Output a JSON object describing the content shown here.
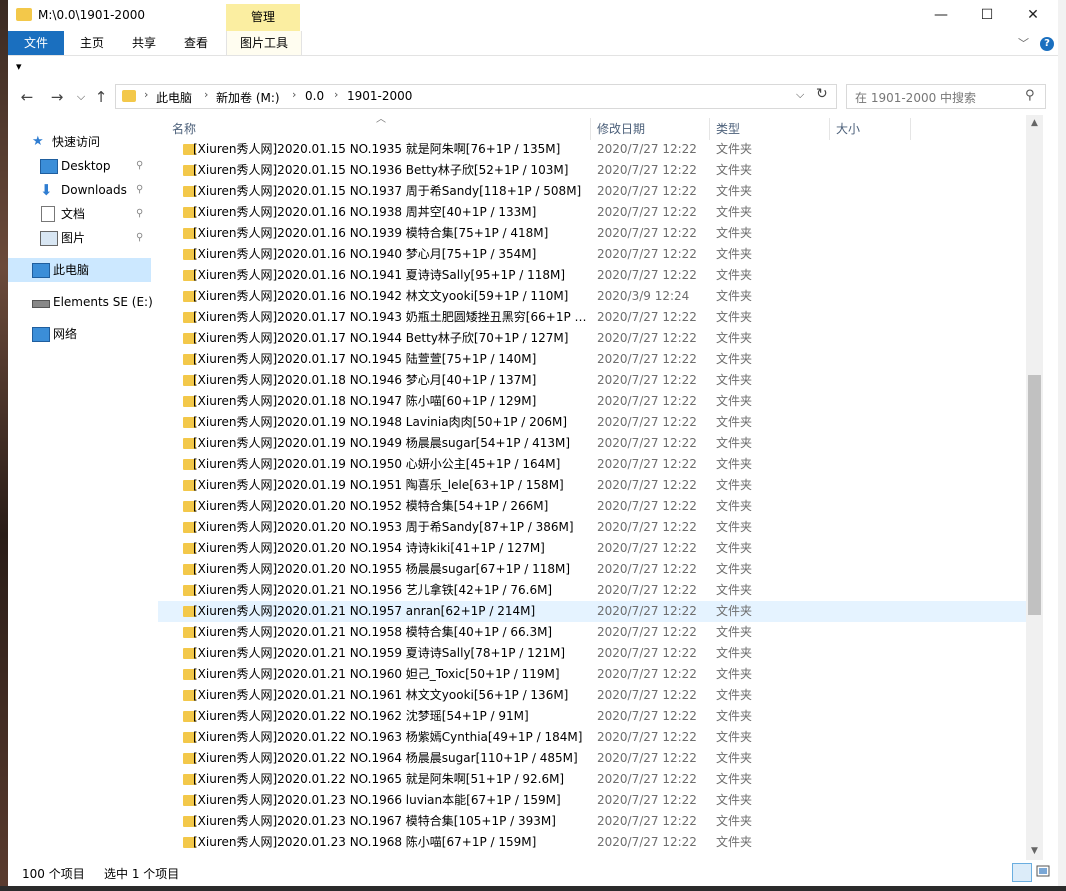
{
  "window": {
    "title": "M:\\0.0\\1901-2000",
    "manage_tab": "管理",
    "minimize": "—",
    "maximize": "☐",
    "close": "✕"
  },
  "ribbon": {
    "tabs": [
      "文件",
      "主页",
      "共享",
      "查看",
      "图片工具"
    ],
    "expand": "﹀",
    "help": "?"
  },
  "qat": {
    "customize": "▾"
  },
  "address": {
    "crumbs": [
      "此电脑",
      "新加卷 (M:)",
      "0.0",
      "1901-2000"
    ],
    "separator": "›",
    "dropdown": "⌵",
    "refresh": "↻",
    "search_placeholder": "在 1901-2000 中搜索"
  },
  "nav_buttons": {
    "back": "←",
    "forward": "→",
    "recent": "⌵",
    "up": "↑"
  },
  "navpane": {
    "items": [
      {
        "label": "快速访问",
        "icon": "star-icon",
        "pinned": false
      },
      {
        "label": "Desktop",
        "icon": "desktop-icon",
        "pinned": true
      },
      {
        "label": "Downloads",
        "icon": "download-icon",
        "pinned": true
      },
      {
        "label": "文档",
        "icon": "documents-icon",
        "pinned": true
      },
      {
        "label": "图片",
        "icon": "pictures-icon",
        "pinned": true
      },
      {
        "label": "此电脑",
        "icon": "computer-icon",
        "pinned": false,
        "selected": true
      },
      {
        "label": "Elements SE (E:)",
        "icon": "drive-icon",
        "pinned": false
      },
      {
        "label": "网络",
        "icon": "network-icon",
        "pinned": false
      }
    ],
    "pin_glyph": "📌"
  },
  "columns": {
    "name": "名称",
    "date": "修改日期",
    "type": "类型",
    "size": "大小"
  },
  "files": [
    {
      "name": "[Xiuren秀人网]2020.01.15 NO.1935 就是阿朱啊[76+1P / 135M]",
      "date": "2020/7/27 12:22",
      "type": "文件夹"
    },
    {
      "name": "[Xiuren秀人网]2020.01.15 NO.1936 Betty林子欣[52+1P / 103M]",
      "date": "2020/7/27 12:22",
      "type": "文件夹"
    },
    {
      "name": "[Xiuren秀人网]2020.01.15 NO.1937 周于希Sandy[118+1P / 508M]",
      "date": "2020/7/27 12:22",
      "type": "文件夹"
    },
    {
      "name": "[Xiuren秀人网]2020.01.16 NO.1938 周丼空[40+1P / 133M]",
      "date": "2020/7/27 12:22",
      "type": "文件夹"
    },
    {
      "name": "[Xiuren秀人网]2020.01.16 NO.1939 模特合集[75+1P / 418M]",
      "date": "2020/7/27 12:22",
      "type": "文件夹"
    },
    {
      "name": "[Xiuren秀人网]2020.01.16 NO.1940 梦心月[75+1P / 354M]",
      "date": "2020/7/27 12:22",
      "type": "文件夹"
    },
    {
      "name": "[Xiuren秀人网]2020.01.16 NO.1941 夏诗诗Sally[95+1P / 118M]",
      "date": "2020/7/27 12:22",
      "type": "文件夹"
    },
    {
      "name": "[Xiuren秀人网]2020.01.16 NO.1942 林文文yooki[59+1P / 110M]",
      "date": "2020/3/9 12:24",
      "type": "文件夹"
    },
    {
      "name": "[Xiuren秀人网]2020.01.17 NO.1943 奶瓶土肥圆矮挫丑黑穷[66+1P / ...",
      "date": "2020/7/27 12:22",
      "type": "文件夹"
    },
    {
      "name": "[Xiuren秀人网]2020.01.17 NO.1944 Betty林子欣[70+1P / 127M]",
      "date": "2020/7/27 12:22",
      "type": "文件夹"
    },
    {
      "name": "[Xiuren秀人网]2020.01.17 NO.1945 陆萱萱[75+1P / 140M]",
      "date": "2020/7/27 12:22",
      "type": "文件夹"
    },
    {
      "name": "[Xiuren秀人网]2020.01.18 NO.1946 梦心月[40+1P / 137M]",
      "date": "2020/7/27 12:22",
      "type": "文件夹"
    },
    {
      "name": "[Xiuren秀人网]2020.01.18 NO.1947 陈小喵[60+1P / 129M]",
      "date": "2020/7/27 12:22",
      "type": "文件夹"
    },
    {
      "name": "[Xiuren秀人网]2020.01.19 NO.1948 Lavinia肉肉[50+1P / 206M]",
      "date": "2020/7/27 12:22",
      "type": "文件夹"
    },
    {
      "name": "[Xiuren秀人网]2020.01.19 NO.1949 杨晨晨sugar[54+1P / 413M]",
      "date": "2020/7/27 12:22",
      "type": "文件夹"
    },
    {
      "name": "[Xiuren秀人网]2020.01.19 NO.1950 心妍小公主[45+1P / 164M]",
      "date": "2020/7/27 12:22",
      "type": "文件夹"
    },
    {
      "name": "[Xiuren秀人网]2020.01.19 NO.1951 陶喜乐_lele[63+1P / 158M]",
      "date": "2020/7/27 12:22",
      "type": "文件夹"
    },
    {
      "name": "[Xiuren秀人网]2020.01.20 NO.1952 模特合集[54+1P / 266M]",
      "date": "2020/7/27 12:22",
      "type": "文件夹"
    },
    {
      "name": "[Xiuren秀人网]2020.01.20 NO.1953 周于希Sandy[87+1P / 386M]",
      "date": "2020/7/27 12:22",
      "type": "文件夹"
    },
    {
      "name": "[Xiuren秀人网]2020.01.20 NO.1954 诗诗kiki[41+1P / 127M]",
      "date": "2020/7/27 12:22",
      "type": "文件夹"
    },
    {
      "name": "[Xiuren秀人网]2020.01.20 NO.1955 杨晨晨sugar[67+1P / 118M]",
      "date": "2020/7/27 12:22",
      "type": "文件夹"
    },
    {
      "name": "[Xiuren秀人网]2020.01.21 NO.1956 艺儿拿铁[42+1P / 76.6M]",
      "date": "2020/7/27 12:22",
      "type": "文件夹"
    },
    {
      "name": "[Xiuren秀人网]2020.01.21 NO.1957 anran[62+1P / 214M]",
      "date": "2020/7/27 12:22",
      "type": "文件夹",
      "selected": true
    },
    {
      "name": "[Xiuren秀人网]2020.01.21 NO.1958 模特合集[40+1P / 66.3M]",
      "date": "2020/7/27 12:22",
      "type": "文件夹"
    },
    {
      "name": "[Xiuren秀人网]2020.01.21 NO.1959 夏诗诗Sally[78+1P / 121M]",
      "date": "2020/7/27 12:22",
      "type": "文件夹"
    },
    {
      "name": "[Xiuren秀人网]2020.01.21 NO.1960 妲己_Toxic[50+1P / 119M]",
      "date": "2020/7/27 12:22",
      "type": "文件夹"
    },
    {
      "name": "[Xiuren秀人网]2020.01.21 NO.1961 林文文yooki[56+1P / 136M]",
      "date": "2020/7/27 12:22",
      "type": "文件夹"
    },
    {
      "name": "[Xiuren秀人网]2020.01.22 NO.1962 沈梦瑶[54+1P / 91M]",
      "date": "2020/7/27 12:22",
      "type": "文件夹"
    },
    {
      "name": "[Xiuren秀人网]2020.01.22 NO.1963 杨紫嫣Cynthia[49+1P / 184M]",
      "date": "2020/7/27 12:22",
      "type": "文件夹"
    },
    {
      "name": "[Xiuren秀人网]2020.01.22 NO.1964 杨晨晨sugar[110+1P / 485M]",
      "date": "2020/7/27 12:22",
      "type": "文件夹"
    },
    {
      "name": "[Xiuren秀人网]2020.01.22 NO.1965 就是阿朱啊[51+1P / 92.6M]",
      "date": "2020/7/27 12:22",
      "type": "文件夹"
    },
    {
      "name": "[Xiuren秀人网]2020.01.23 NO.1966 luvian本能[67+1P / 159M]",
      "date": "2020/7/27 12:22",
      "type": "文件夹"
    },
    {
      "name": "[Xiuren秀人网]2020.01.23 NO.1967 模特合集[105+1P / 393M]",
      "date": "2020/7/27 12:22",
      "type": "文件夹"
    },
    {
      "name": "[Xiuren秀人网]2020.01.23 NO.1968 陈小喵[67+1P / 159M]",
      "date": "2020/7/27 12:22",
      "type": "文件夹"
    }
  ],
  "status": {
    "count": "100 个项目",
    "selected": "选中 1 个项目"
  },
  "colors": {
    "accent": "#1a6fbf",
    "manage_tab": "#fbeea1",
    "selection": "#e5f3ff",
    "folder": "#f3c84a",
    "nav_selected": "#cce8ff"
  }
}
